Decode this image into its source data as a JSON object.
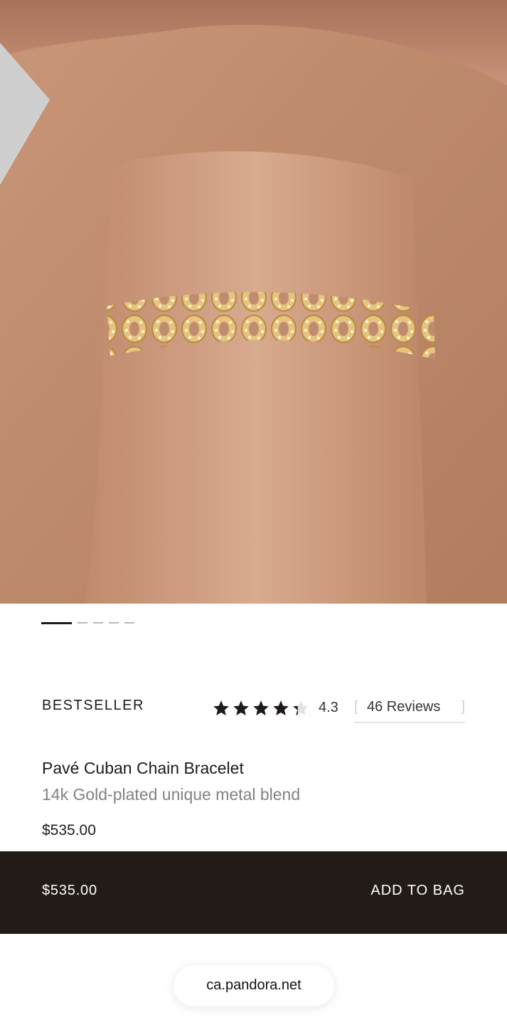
{
  "carousel": {
    "slide_count": 5,
    "active_index": 0
  },
  "product": {
    "badge": "BESTSELLER",
    "name": "Pavé Cuban Chain Bracelet",
    "material": "14k Gold-plated unique metal blend",
    "price": "$535.00"
  },
  "rating": {
    "value": "4.3",
    "stars_filled_fraction": 0.86,
    "bracket_open": "[",
    "reviews_label": "46 Reviews",
    "bracket_close": "]"
  },
  "sticky_bar": {
    "price": "$535.00",
    "cta_label": "ADD TO BAG"
  },
  "browser": {
    "url": "ca.pandora.net"
  },
  "colors": {
    "bar_bg": "#221b17",
    "text_primary": "#1e1a18",
    "text_secondary": "#828282",
    "gold": "#d9b36a"
  }
}
